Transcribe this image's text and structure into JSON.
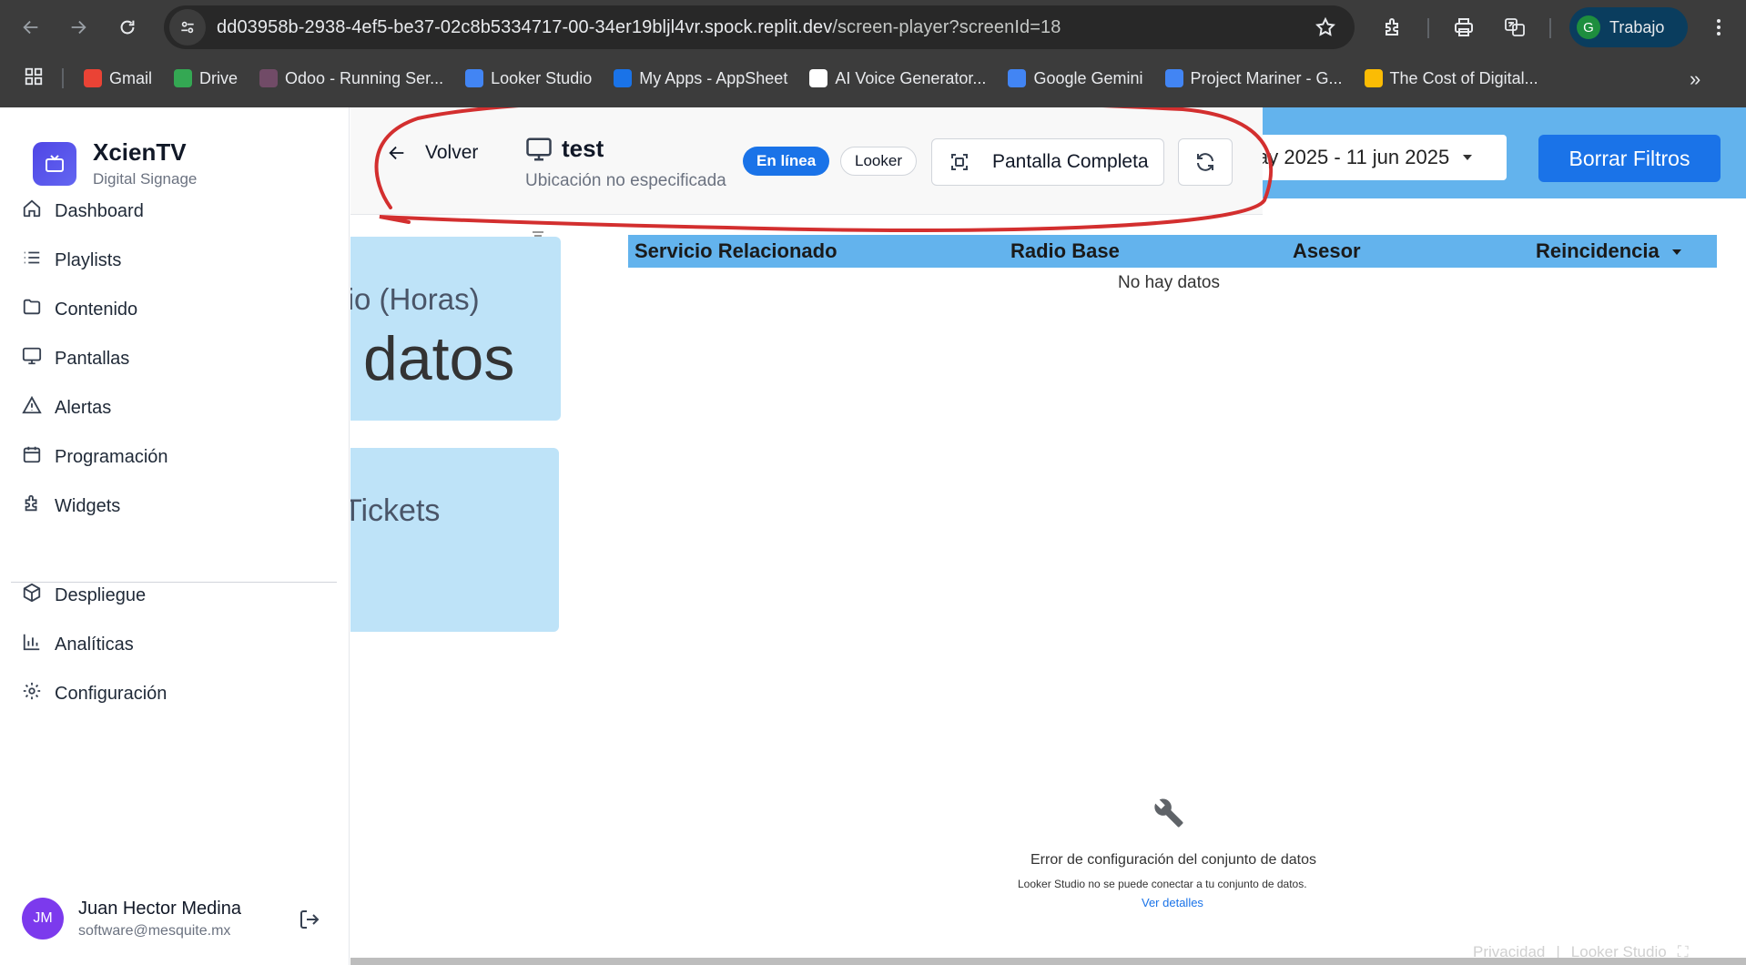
{
  "browser": {
    "url_main": "dd03958b-2938-4ef5-be37-02c8b5334717-00-34er19bljl4vr.spock.replit.dev",
    "url_path": "/screen-player?screenId=18",
    "profile_initial": "G",
    "profile_label": "Trabajo",
    "bookmarks": [
      {
        "label": "Gmail",
        "color": "#ea4335"
      },
      {
        "label": "Drive",
        "color": "#34a853"
      },
      {
        "label": "Odoo - Running Ser...",
        "color": "#714b67"
      },
      {
        "label": "Looker Studio",
        "color": "#4285f4"
      },
      {
        "label": "My Apps - AppSheet",
        "color": "#1a73e8"
      },
      {
        "label": "AI Voice Generator...",
        "color": "#ffffff"
      },
      {
        "label": "Google Gemini",
        "color": "#4285f4"
      },
      {
        "label": "Project Mariner - G...",
        "color": "#4285f4"
      },
      {
        "label": "The Cost of Digital...",
        "color": "#fbbc04"
      }
    ]
  },
  "sidebar": {
    "brand_name": "XcienTV",
    "brand_sub": "Digital Signage",
    "items": [
      {
        "label": "Dashboard",
        "icon": "home-icon"
      },
      {
        "label": "Playlists",
        "icon": "list-icon"
      },
      {
        "label": "Contenido",
        "icon": "folder-icon"
      },
      {
        "label": "Pantallas",
        "icon": "monitor-icon"
      },
      {
        "label": "Alertas",
        "icon": "alert-triangle-icon"
      },
      {
        "label": "Programación",
        "icon": "calendar-icon"
      },
      {
        "label": "Widgets",
        "icon": "puzzle-icon"
      },
      {
        "label": "Despliegue",
        "icon": "package-icon"
      },
      {
        "label": "Analíticas",
        "icon": "bar-chart-icon"
      },
      {
        "label": "Configuración",
        "icon": "gear-icon"
      }
    ],
    "user": {
      "initials": "JM",
      "name": "Juan Hector Medina",
      "email": "software@mesquite.mx"
    }
  },
  "player": {
    "back_label": "Volver",
    "screen_name": "test",
    "location": "Ubicación no especificada",
    "status_badge": "En línea",
    "type_badge": "Looker",
    "fullscreen_label": "Pantalla Completa"
  },
  "report": {
    "date_range": "ay 2025 - 11 jun 2025",
    "clear_filters": "Borrar Filtros",
    "card1_label": "edio (Horas)",
    "card1_value": "datos",
    "card2_label": "Tickets",
    "table_headers": [
      "Servicio Relacionado",
      "Radio Base",
      "Asesor",
      "Reincidencia"
    ],
    "no_data": "No hay datos",
    "error_title": "Error de configuración del conjunto de datos",
    "error_sub": "Looker Studio no se puede conectar a tu conjunto de datos.",
    "error_link": "Ver detalles",
    "footer_privacy": "Privacidad",
    "footer_brand": "Looker Studio"
  },
  "colors": {
    "chrome_bg": "#3c3c3c",
    "report_blue": "#63b3ed",
    "card_blue": "#bee3f8",
    "accent_blue": "#1a73e8",
    "annotation_red": "#d32f2f"
  }
}
